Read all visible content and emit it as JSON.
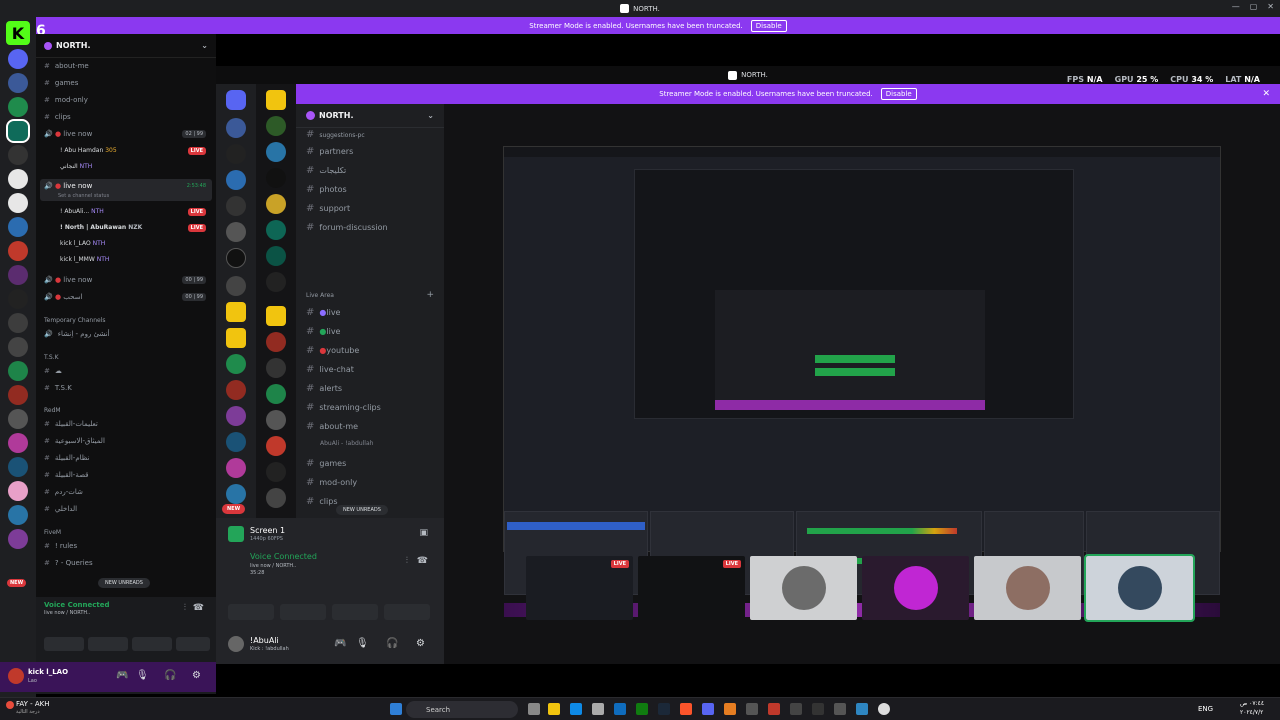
{
  "window": {
    "title": "NORTH.",
    "controls": [
      "—",
      "▢",
      "✕"
    ]
  },
  "streamer_banner": {
    "text": "Streamer Mode is enabled. Usernames have been truncated.",
    "button": "Disable"
  },
  "kick_badge": "6",
  "outer": {
    "server_name": "NORTH.",
    "channels": [
      {
        "label": "about-me"
      },
      {
        "label": "games"
      },
      {
        "label": "mod-only"
      },
      {
        "label": "clips"
      }
    ],
    "voice1": {
      "label": "live now",
      "count": "02 | 99",
      "users": [
        {
          "name": "! Abu Hamdan",
          "tag": "305",
          "live": "LIVE"
        },
        {
          "name": "النجاني",
          "tag": "NTH",
          "live": ""
        }
      ]
    },
    "voice2": {
      "label": "live now",
      "time": "2:53:48",
      "status": "Set a channel status",
      "users": [
        {
          "name": "! AbuAli...",
          "tag": "NTH",
          "live": "LIVE"
        },
        {
          "name": "! North | AbuRawan",
          "tag": "NZK",
          "live": "LIVE"
        },
        {
          "name": "kick l_LAO",
          "tag": "NTH",
          "live": ""
        },
        {
          "name": "kick l_MMW",
          "tag": "NTH",
          "live": ""
        }
      ]
    },
    "voice3": {
      "label": "live now",
      "count": "00 | 99"
    },
    "voice4": {
      "label": "اسحب",
      "count": "00 | 99"
    },
    "cat_temp": "Temporary Channels",
    "temp_item": "أنشئ روم - اِنشاء",
    "cat_tsk": "T.S.K",
    "tsk_items": [
      "☁",
      "T.S.K"
    ],
    "cat_redm": "RedM",
    "redm_items": [
      "تعليمات-القبيلة",
      "الميثاق-الاسبوعية",
      "نظام-القبيلة",
      "قصة-القبيلة",
      "شات-ردم",
      "الداخلي"
    ],
    "cat_fivem": "FiveM",
    "fivem_items": [
      "! rules",
      "? - Queries"
    ],
    "new_unreads": "NEW UNREADS",
    "voice_connected": "Voice Connected",
    "voice_sub": "live now / NORTH..",
    "user": {
      "name": "kick l_LAO",
      "status": "Lao"
    }
  },
  "inner": {
    "title": "NORTH.",
    "stats": [
      {
        "label": "FPS",
        "value": "N/A"
      },
      {
        "label": "GPU",
        "value": "25 %"
      },
      {
        "label": "CPU",
        "value": "34 %"
      },
      {
        "label": "LAT",
        "value": "N/A"
      }
    ],
    "server_name": "NORTH.",
    "channels": [
      "suggestions-pc",
      "partners",
      "تكليجات",
      "photos",
      "support",
      "forum-discussion"
    ],
    "cat_live": "Live Area",
    "live_items": [
      {
        "label": "live",
        "dot": "#8b6cff"
      },
      {
        "label": "live",
        "dot": "#23a559"
      },
      {
        "label": "youtube",
        "dot": "#da373c"
      },
      {
        "label": "live-chat",
        "dot": ""
      },
      {
        "label": "alerts",
        "dot": ""
      },
      {
        "label": "streaming-clips",
        "dot": ""
      },
      {
        "label": "about-me",
        "dot": ""
      }
    ],
    "about_sub": "AbuAli - !abdullah",
    "more_items": [
      "games",
      "mod-only",
      "clips"
    ],
    "new_unreads": "NEW UNREADS",
    "new_pill": "NEW",
    "screen": {
      "title": "Screen 1",
      "sub": "1440p 60FPS"
    },
    "voice_connected": "Voice Connected",
    "voice_sub": "live now / NORTH..",
    "voice_time": "35:28",
    "user": {
      "name": "!AbuAli",
      "status": "Kick : !abdullah"
    }
  },
  "thumbs": [
    {
      "live": "LIVE"
    },
    {
      "live": "LIVE"
    },
    {
      "live": ""
    },
    {
      "live": ""
    },
    {
      "live": ""
    },
    {
      "live": ""
    }
  ],
  "taskbar": {
    "search": "Search",
    "lang": "ENG",
    "weather": "FAY - AKH",
    "weather_sub": "درجة الثالية",
    "clock": "٠٧:٤٤ ص",
    "date": "٢٠٢٤/٧/٢"
  },
  "colors": {
    "accent": "#8b39f0",
    "live": "#da373c",
    "green": "#23a559"
  }
}
